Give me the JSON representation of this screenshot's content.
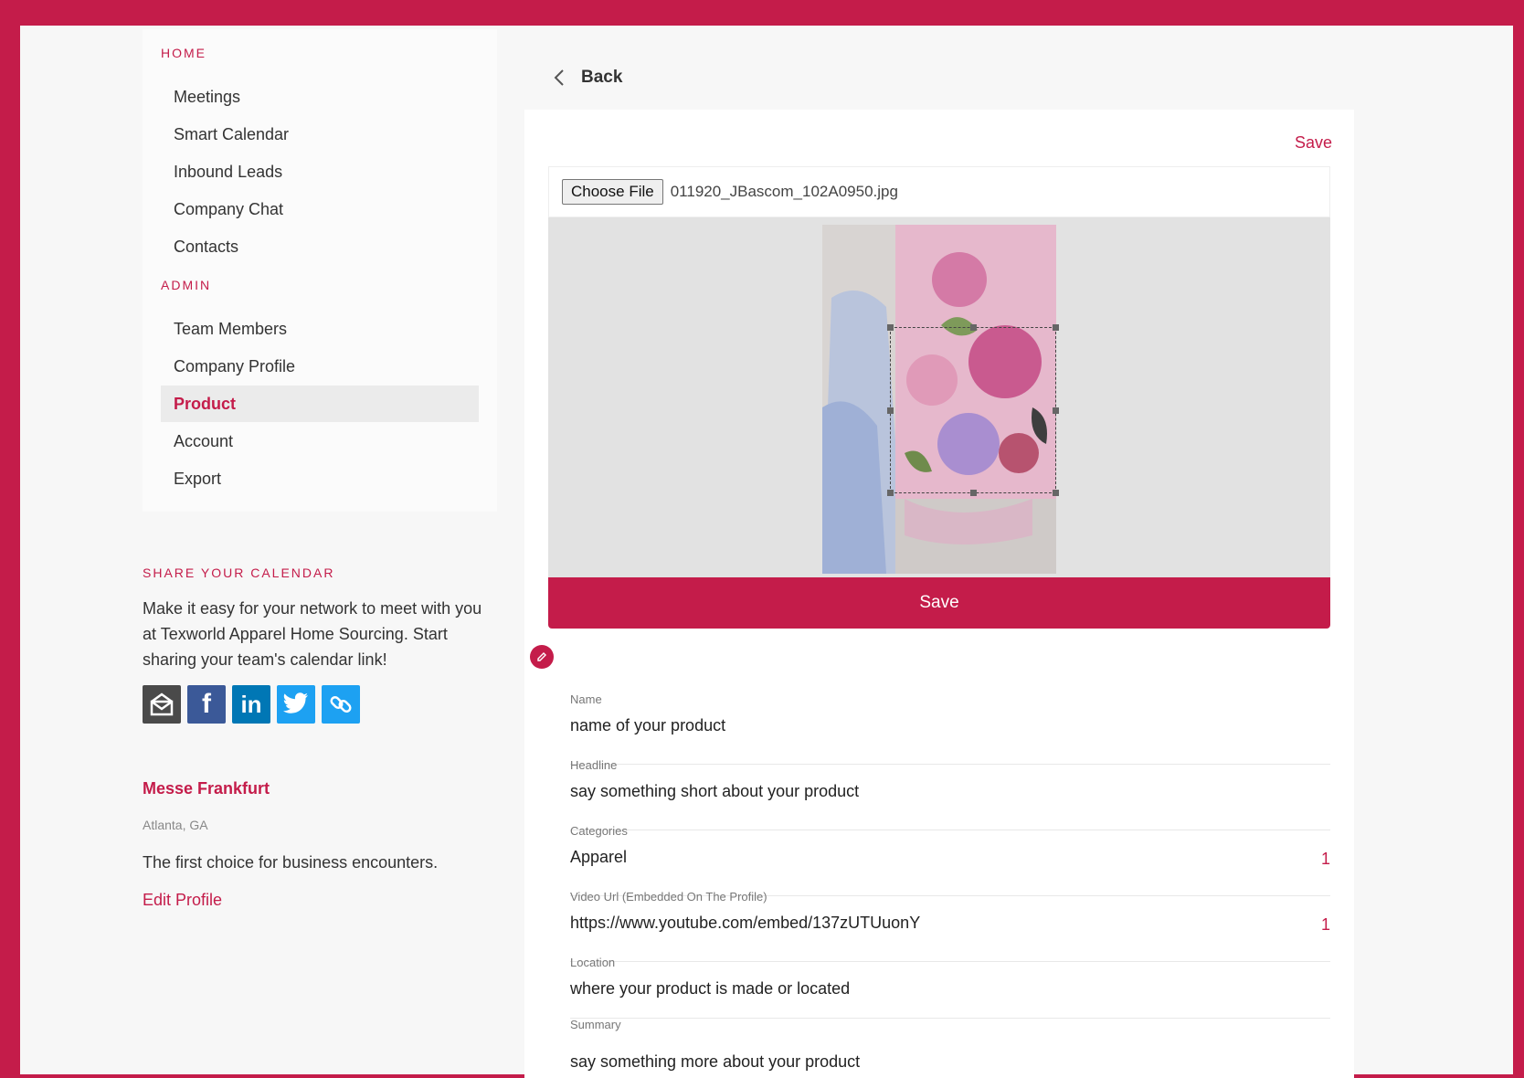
{
  "sidebar": {
    "home_label": "HOME",
    "home_items": [
      "Meetings",
      "Smart Calendar",
      "Inbound Leads",
      "Company Chat",
      "Contacts"
    ],
    "admin_label": "ADMIN",
    "admin_items": [
      "Team Members",
      "Company Profile",
      "Product",
      "Account",
      "Export"
    ],
    "active_item": "Product"
  },
  "share": {
    "title": "SHARE YOUR CALENDAR",
    "text": "Make it easy for your network to meet with you at Texworld Apparel Home Sourcing. Start sharing your team's calendar link!",
    "icons": [
      "email-icon",
      "facebook-icon",
      "linkedin-icon",
      "twitter-icon",
      "link-icon"
    ]
  },
  "company": {
    "name": "Messe Frankfurt",
    "location": "Atlanta, GA",
    "description": "The first choice for business encounters.",
    "edit_label": "Edit Profile"
  },
  "header": {
    "back_label": "Back"
  },
  "editor": {
    "save_link": "Save",
    "choose_file_label": "Choose File",
    "file_name": "011920_JBascom_102A0950.jpg",
    "save_button": "Save"
  },
  "fields": {
    "name": {
      "label": "Name",
      "value": "name of your product"
    },
    "headline": {
      "label": "Headline",
      "value": "say something short about your product"
    },
    "categories": {
      "label": "Categories",
      "value": "Apparel",
      "count": "1"
    },
    "video": {
      "label": "Video Url (Embedded On The Profile)",
      "value": "https://www.youtube.com/embed/137zUTUuonY",
      "count": "1"
    },
    "location": {
      "label": "Location",
      "value": "where your product is made or located"
    },
    "summary": {
      "label": "Summary",
      "value": "say something more about your product"
    }
  },
  "colors": {
    "accent": "#c41c4a",
    "background": "#f7f7f7"
  }
}
